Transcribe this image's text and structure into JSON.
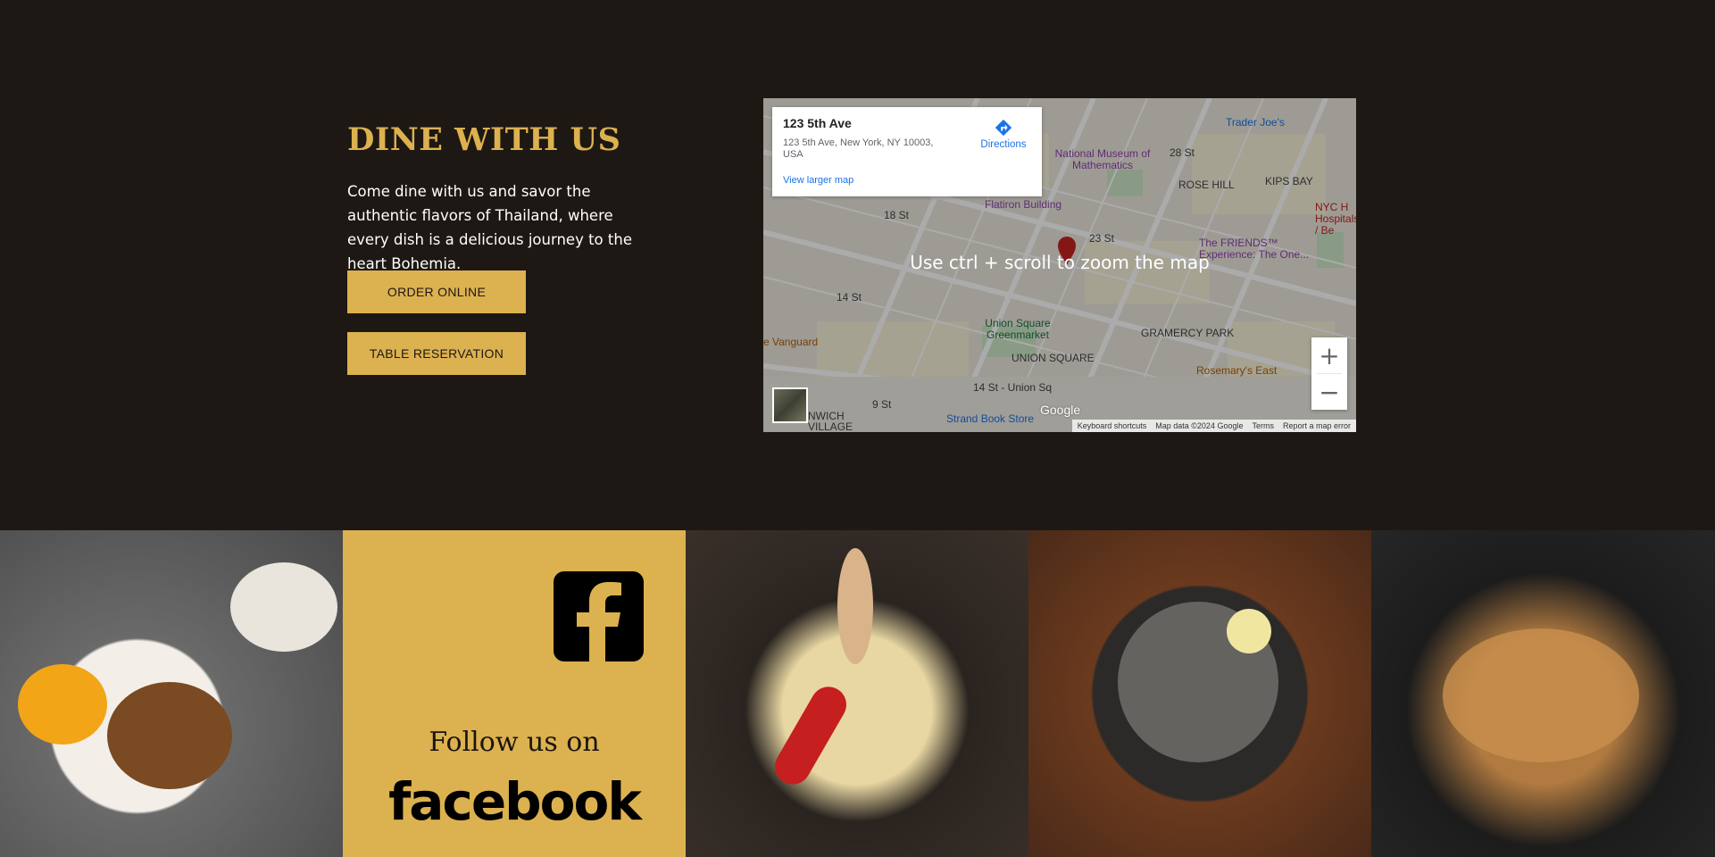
{
  "section": {
    "heading": "DINE WITH US",
    "description": "Come dine with us and savor the authentic flavors of Thailand, where every dish is a delicious journey to the heart Bohemia.",
    "order_label": "ORDER ONLINE",
    "reservation_label": "TABLE RESERVATION"
  },
  "map": {
    "place_title": "123 5th Ave",
    "address": "123 5th Ave, New York, NY 10003, USA",
    "view_larger": "View larger map",
    "directions": "Directions",
    "overlay_message": "Use ctrl + scroll to zoom the map",
    "zoom_in": "+",
    "zoom_out": "−",
    "google": "Google",
    "keyboard_shortcuts": "Keyboard shortcuts",
    "map_data": "Map data ©2024 Google",
    "terms": "Terms",
    "report": "Report a map error",
    "labels": {
      "trader_joes": "Trader Joe's",
      "museum": "National Museum of Mathematics",
      "rose_hill": "ROSE HILL",
      "kips_bay": "KIPS BAY",
      "flatiron": "Flatiron Building",
      "friends": "The FRIENDS™ Experience: The One...",
      "union_square_greenmarket": "Union Square Greenmarket",
      "gramercy": "GRAMERCY PARK",
      "union_square": "UNION SQUARE",
      "vanguard": "e Vanguard",
      "rosemarys": "Rosemary's East",
      "union_sq_station": "14 St - Union Sq",
      "strand": "Strand Book Store",
      "greenwich": "NWICH VILLAGE",
      "st_23": "23 St",
      "st_28": "28 St",
      "st_18": "18 St",
      "st_14": "14 St",
      "st_9": "9 St",
      "nyc_health": "NYC H Hospitals / Be"
    }
  },
  "gallery": {
    "follow_text": "Follow us on",
    "brand_text": "facebook"
  },
  "colors": {
    "background": "#1e1814",
    "accent": "#dcb14f"
  }
}
